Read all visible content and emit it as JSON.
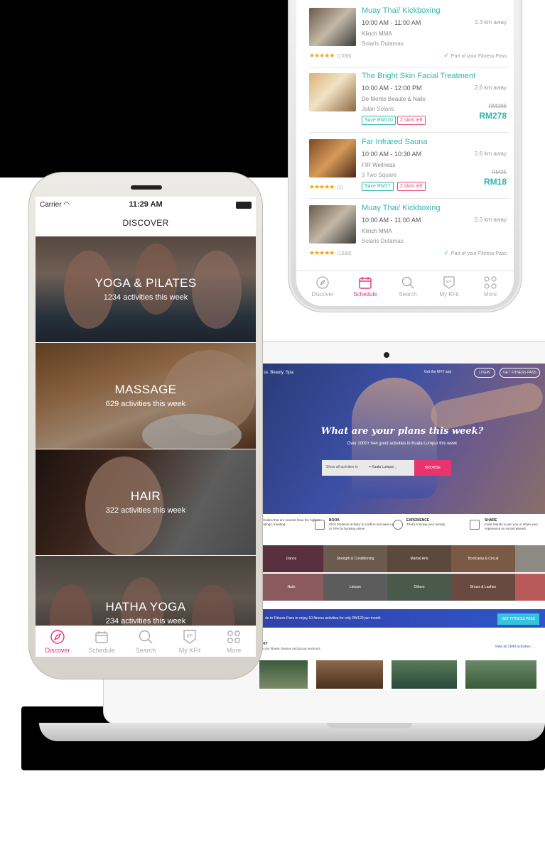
{
  "top_phone": {
    "schedule_items": [
      {
        "title": "Muay Thai/ Kickboxing",
        "time": "10:00 AM - 11:00 AM",
        "distance": "2.3 km away",
        "venue": "Klinch MMA",
        "area": "Solaris Dutamas",
        "rating_count": "(1038)",
        "pass_note": "Part of your Fitness Pass",
        "rating": 4.5
      },
      {
        "title": "The Bright Skin Facial Treatment",
        "time": "10:00 AM - 12:00 PM",
        "distance": "2.6 km away",
        "venue": "De Monte Beaute & Nails",
        "area": "Jalan Solaris",
        "save": "Save RM110",
        "slots": "2 slots left",
        "old_price": "RM388",
        "new_price": "RM278"
      },
      {
        "title": "Far Infrared Sauna",
        "time": "10:00 AM - 10:30 AM",
        "distance": "2.6 km away",
        "venue": "FIR Wellness",
        "area": "3 Two Square",
        "rating_count": "(1)",
        "save": "Save RM17",
        "slots": "2 slots left",
        "old_price": "RM35",
        "new_price": "RM18",
        "rating": 5
      },
      {
        "title": "Muay Thai/ Kickboxing",
        "time": "10:00 AM - 11:00 AM",
        "distance": "2.3 km away",
        "venue": "Klinch MMA",
        "area": "Solaris Dutamas",
        "rating_count": "(1038)",
        "pass_note": "Part of your Fitness Pass",
        "rating": 4.5
      }
    ],
    "tabs": [
      {
        "label": "Discover",
        "icon": "compass-icon"
      },
      {
        "label": "Schedule",
        "icon": "calendar-icon",
        "active": true
      },
      {
        "label": "Search",
        "icon": "search-icon"
      },
      {
        "label": "My KFit",
        "icon": "kfit-badge-icon"
      },
      {
        "label": "More",
        "icon": "grid-icon"
      }
    ]
  },
  "web": {
    "tagline": "ss. Beauty. Spa.",
    "get_app": "Get the KFIT app",
    "login": "LOGIN",
    "get_pass": "GET FITNESS PASS",
    "headline": "What are your plans this week?",
    "subhead": "Over 1000+ feel good activities in Kuala Lumpur this week",
    "search_placeholder": "Show all activities in",
    "location": "Kuala Lumpur",
    "browse": "BROWSE",
    "steps": [
      {
        "title": "",
        "text": "ctivities that are nearest have the highest ratings, trending"
      },
      {
        "title": "BOOK",
        "text": "Click 'Reserve activity' to confirm and save up to 70% by booking online"
      },
      {
        "title": "EXPERIENCE",
        "text": "That's it! Enjoy your activity"
      },
      {
        "title": "SHARE",
        "text": "Invite friends to join you or share your experience on social network"
      }
    ],
    "categories": [
      "Dance",
      "Strength & Conditioning",
      "Martial Arts",
      "Bootcamp & Circuit",
      "Nails",
      "Leisure",
      "Others",
      "Brows & Lashes"
    ],
    "banner_text": "de to Fitness Pass to enjoy 10 fitness activities for only RM129 per month.",
    "banner_button": "GET FITNESS PASS",
    "section_title": "FIT",
    "section_sub": "y join fitness classes and group workouts",
    "view_all": "View all 2849 activities →"
  },
  "main_phone": {
    "carrier": "Carrier",
    "time": "11:29 AM",
    "title": "DISCOVER",
    "tiles": [
      {
        "title": "YOGA & PILATES",
        "subtitle": "1234 activities this week"
      },
      {
        "title": "MASSAGE",
        "subtitle": "629 activities this week"
      },
      {
        "title": "HAIR",
        "subtitle": "322 activities this week"
      },
      {
        "title": "HATHA YOGA",
        "subtitle": "234 activities this week"
      }
    ],
    "tabs": [
      {
        "label": "Discover",
        "icon": "compass-icon",
        "active": true
      },
      {
        "label": "Schedule",
        "icon": "calendar-icon"
      },
      {
        "label": "Search",
        "icon": "search-icon"
      },
      {
        "label": "My KFit",
        "icon": "kfit-badge-icon"
      },
      {
        "label": "More",
        "icon": "grid-icon"
      }
    ]
  },
  "colors": {
    "accent": "#e8336f",
    "teal": "#2fb5a8",
    "star": "#f0a021",
    "web_primary": "#3042a8"
  }
}
